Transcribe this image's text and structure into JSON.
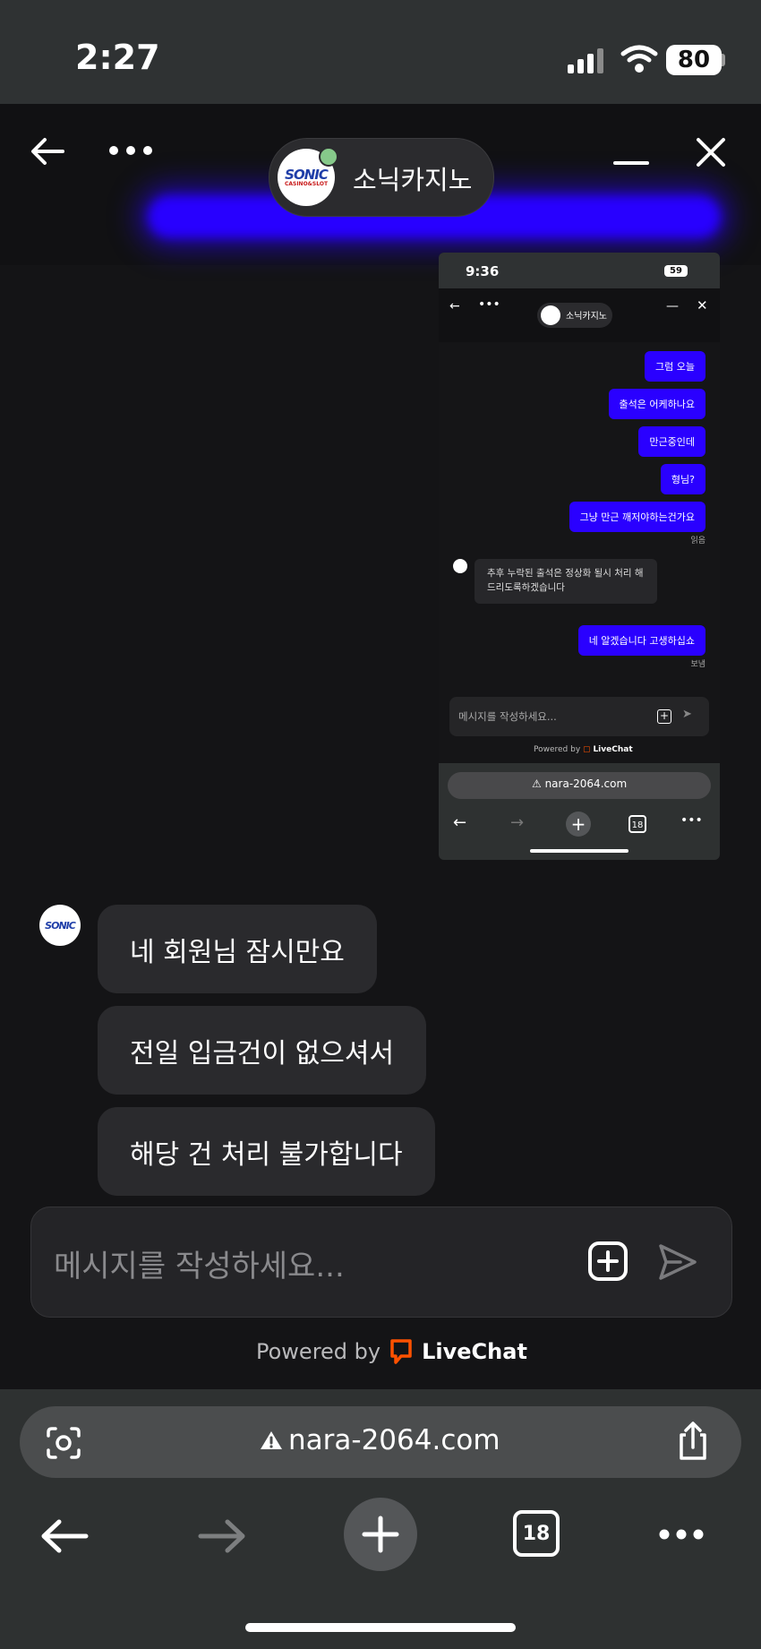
{
  "status_bar": {
    "time": "2:27",
    "battery": "80"
  },
  "chat_header": {
    "title": "소닉카지노",
    "logo_text": "SONIC",
    "logo_sub": "CASINO&SLOT"
  },
  "embedded_screenshot": {
    "time": "9:36",
    "battery": "59",
    "title": "소닉카지노",
    "messages_sent": [
      "그럼 오늘",
      "출석은 어케하나요",
      "만근중인데",
      "형님?",
      "그냥 만근 깨저야하는건가요"
    ],
    "read_label": "읽음",
    "agent_reply": "추후 누락된 출석은 정상화 될시 처리 해드리도록하겠습니다",
    "last_sent": "네 알겠습니다 고생하십쇼",
    "sent_label": "보냄",
    "input_placeholder": "메시지를 작성하세요...",
    "powered_by": "Powered by",
    "livechat": "LiveChat",
    "url": "nara-2064.com",
    "tabs_count": "18"
  },
  "messages": [
    {
      "text": "네 회원님 잠시만요"
    },
    {
      "text": "전일 입금건이 없으셔서"
    },
    {
      "text": "해당 건 처리 불가합니다"
    }
  ],
  "composer": {
    "placeholder": "메시지를 작성하세요..."
  },
  "footer": {
    "powered_by": "Powered by",
    "brand": "LiveChat"
  },
  "browser": {
    "url": "nara-2064.com",
    "tabs_count": "18"
  },
  "colors": {
    "accent_blue": "#2a00ff",
    "livechat_orange": "#ff5100",
    "online": "#86c98a"
  }
}
